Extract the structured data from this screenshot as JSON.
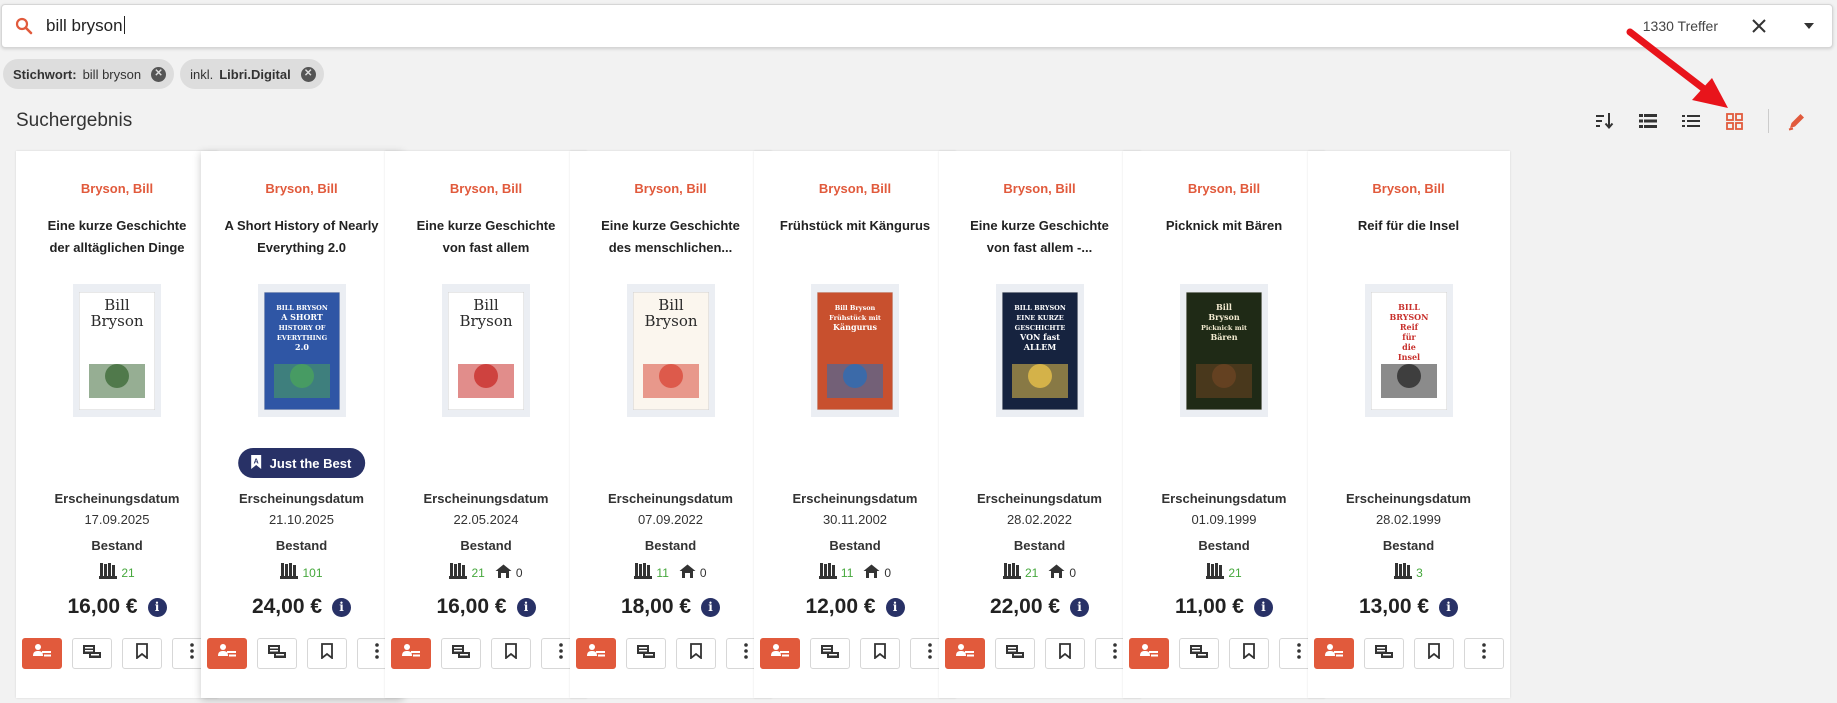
{
  "search": {
    "query": "bill bryson",
    "hits": "1330 Treffer"
  },
  "chips": [
    {
      "key": "Stichwort:",
      "value": "bill bryson"
    },
    {
      "prefix": "inkl.",
      "value": "Libri.Digital"
    }
  ],
  "results_title": "Suchergebnis",
  "labels": {
    "pub": "Erscheinungsdatum",
    "stock": "Bestand",
    "badge": "Just the Best"
  },
  "colors": {
    "accent": "#e15a3c",
    "navy": "#283166",
    "stock_green": "#46a83d"
  },
  "icons": [
    "search-icon",
    "close-icon",
    "chevron-down-icon",
    "sort-icon",
    "list-detail-view-icon",
    "list-view-icon",
    "grid-view-icon",
    "pencil-icon",
    "red-arrow-annotation",
    "libri-icon",
    "store-icon",
    "info-icon",
    "order-icon",
    "stock-icon",
    "bookmark-icon",
    "more-icon"
  ],
  "cards": [
    {
      "author": "Bryson, Bill",
      "title": "Eine kurze Geschichte der alltäglichen Dinge",
      "date": "17.09.2025",
      "libri": "21",
      "store": null,
      "price": "16,00 €",
      "badge": false,
      "cover": {
        "bg": "#ffffff",
        "fg": "#2b2b2b",
        "accent": "#3f6b3a",
        "lines": [
          "Bill",
          "Bryson"
        ]
      }
    },
    {
      "author": "Bryson, Bill",
      "title": "A Short History of Nearly Everything 2.0",
      "date": "21.10.2025",
      "libri": "101",
      "store": null,
      "price": "24,00 €",
      "badge": true,
      "cover": {
        "bg": "#2f56a5",
        "fg": "#ffffff",
        "accent": "#4aa35c",
        "lines": [
          "BILL BRYSON",
          "A SHORT",
          "HISTORY OF",
          "EVERYTHING",
          "2.0"
        ]
      }
    },
    {
      "author": "Bryson, Bill",
      "title": "Eine kurze Geschichte von fast allem",
      "date": "22.05.2024",
      "libri": "21",
      "store": "0",
      "price": "16,00 €",
      "badge": false,
      "cover": {
        "bg": "#ffffff",
        "fg": "#2b2b2b",
        "accent": "#c9302c",
        "lines": [
          "Bill",
          "Bryson"
        ]
      }
    },
    {
      "author": "Bryson, Bill",
      "title": "Eine kurze Geschichte des menschlichen...",
      "date": "07.09.2022",
      "libri": "11",
      "store": "0",
      "price": "18,00 €",
      "badge": false,
      "cover": {
        "bg": "#fbf6ee",
        "fg": "#2b2b2b",
        "accent": "#d94b3b",
        "lines": [
          "Bill",
          "Bryson"
        ]
      }
    },
    {
      "author": "Bryson, Bill",
      "title": "Frühstück mit Kängurus",
      "date": "30.11.2002",
      "libri": "11",
      "store": "0",
      "price": "12,00 €",
      "badge": false,
      "cover": {
        "bg": "#c8502e",
        "fg": "#ffffff",
        "accent": "#2d6db5",
        "lines": [
          "Bill Bryson",
          "Frühstück mit",
          "Kängurus"
        ]
      }
    },
    {
      "author": "Bryson, Bill",
      "title": "Eine kurze Geschichte von fast allem -...",
      "date": "28.02.2022",
      "libri": "21",
      "store": "0",
      "price": "22,00 €",
      "badge": false,
      "cover": {
        "bg": "#16233f",
        "fg": "#ffffff",
        "accent": "#e7c14a",
        "lines": [
          "BILL BRYSON",
          "EINE KURZE",
          "GESCHICHTE",
          "VON fast",
          "ALLEM"
        ]
      }
    },
    {
      "author": "Bryson, Bill",
      "title": "Picknick mit Bären",
      "date": "01.09.1999",
      "libri": "21",
      "store": null,
      "price": "11,00 €",
      "badge": false,
      "cover": {
        "bg": "#1f2a16",
        "fg": "#f2ead0",
        "accent": "#6b4423",
        "lines": [
          "Bill",
          "Bryson",
          "Picknick mit",
          "Bären"
        ]
      }
    },
    {
      "author": "Bryson, Bill",
      "title": "Reif für die Insel",
      "date": "28.02.1999",
      "libri": "3",
      "store": null,
      "price": "13,00 €",
      "badge": false,
      "cover": {
        "bg": "#ffffff",
        "fg": "#c8302c",
        "accent": "#2b2b2b",
        "lines": [
          "BILL",
          "BRYSON",
          "Reif",
          "für",
          "die",
          "Insel"
        ]
      }
    }
  ]
}
